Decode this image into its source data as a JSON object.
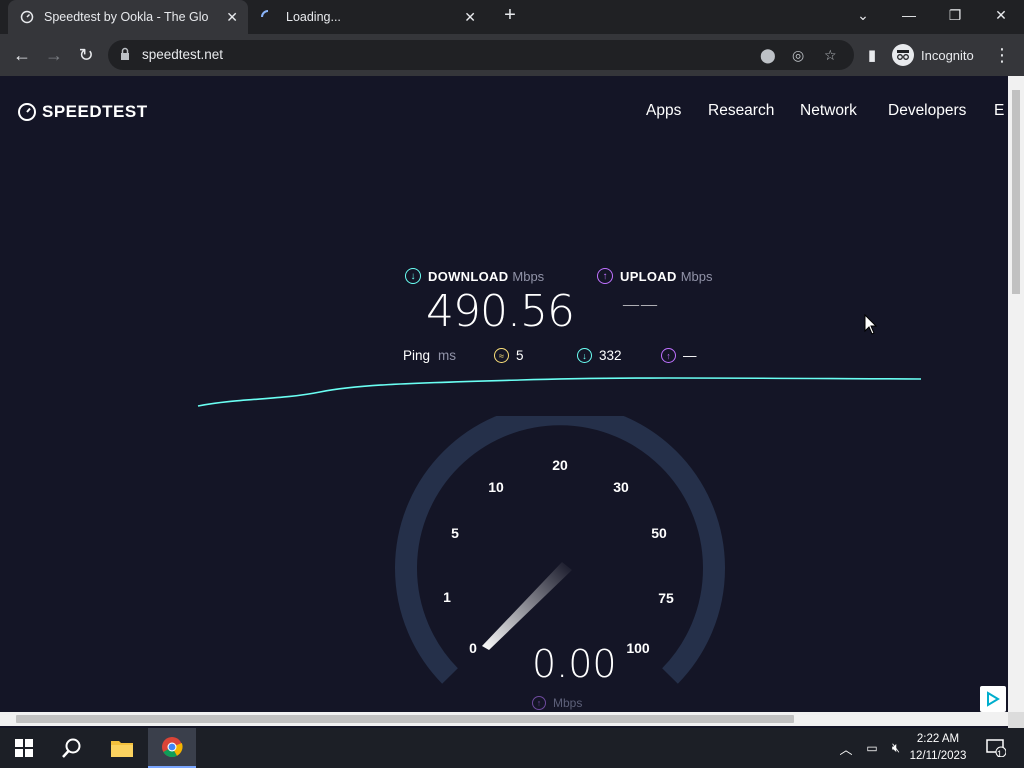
{
  "browser": {
    "tabs": [
      {
        "title": "Speedtest by Ookla - The Global",
        "icon": "speedtest-favicon"
      },
      {
        "title": "Loading...",
        "icon": "loading-spinner-icon"
      }
    ],
    "url": "speedtest.net",
    "profile_label": "Incognito"
  },
  "site": {
    "logo_text": "SPEEDTEST",
    "nav": [
      "Apps",
      "Research",
      "Network",
      "Developers",
      "E"
    ]
  },
  "results": {
    "download_label": "DOWNLOAD",
    "download_unit": "Mbps",
    "download_value": "490.56",
    "upload_label": "UPLOAD",
    "upload_unit": "Mbps",
    "upload_value": "——",
    "ping_label": "Ping",
    "ping_unit": "ms",
    "ping_idle": "5",
    "ping_download": "332",
    "ping_upload": "—"
  },
  "gauge": {
    "ticks": [
      "0",
      "1",
      "5",
      "10",
      "20",
      "30",
      "50",
      "75",
      "100"
    ],
    "reading": "0.00",
    "unit": "Mbps"
  },
  "taskbar": {
    "time": "2:22 AM",
    "date": "12/11/2023",
    "notification_count": "1"
  },
  "colors": {
    "page_bg": "#141526",
    "accent_cyan": "#6afff3",
    "accent_purple": "#bf71ff",
    "ping_yellow": "#fbe07a",
    "gauge_track": "#25304a"
  }
}
